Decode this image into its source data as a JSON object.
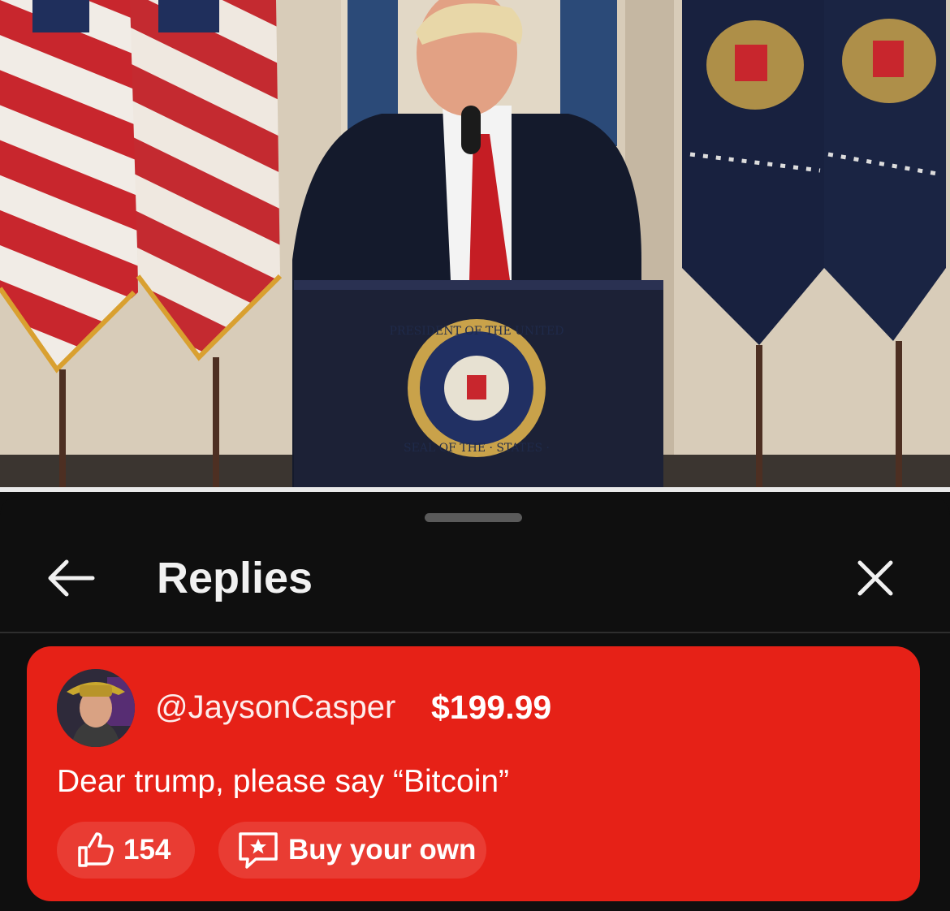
{
  "video": {
    "progress": 1.0,
    "description_icon": "video-frame",
    "seal": {
      "top_text": "PRESIDENT OF THE UNITED",
      "bottom_text": "SEAL OF THE · STATES ·"
    }
  },
  "panel": {
    "title": "Replies",
    "back_icon": "arrow-left-icon",
    "close_icon": "close-icon"
  },
  "super_chat": {
    "author": "@JaysonCasper",
    "amount": "$199.99",
    "message": "Dear trump, please say “Bitcoin”",
    "likes": "154",
    "like_icon": "thumbs-up-icon",
    "buy_label": "Buy your own",
    "buy_icon": "super-chat-icon",
    "card_color": "#e62117"
  }
}
